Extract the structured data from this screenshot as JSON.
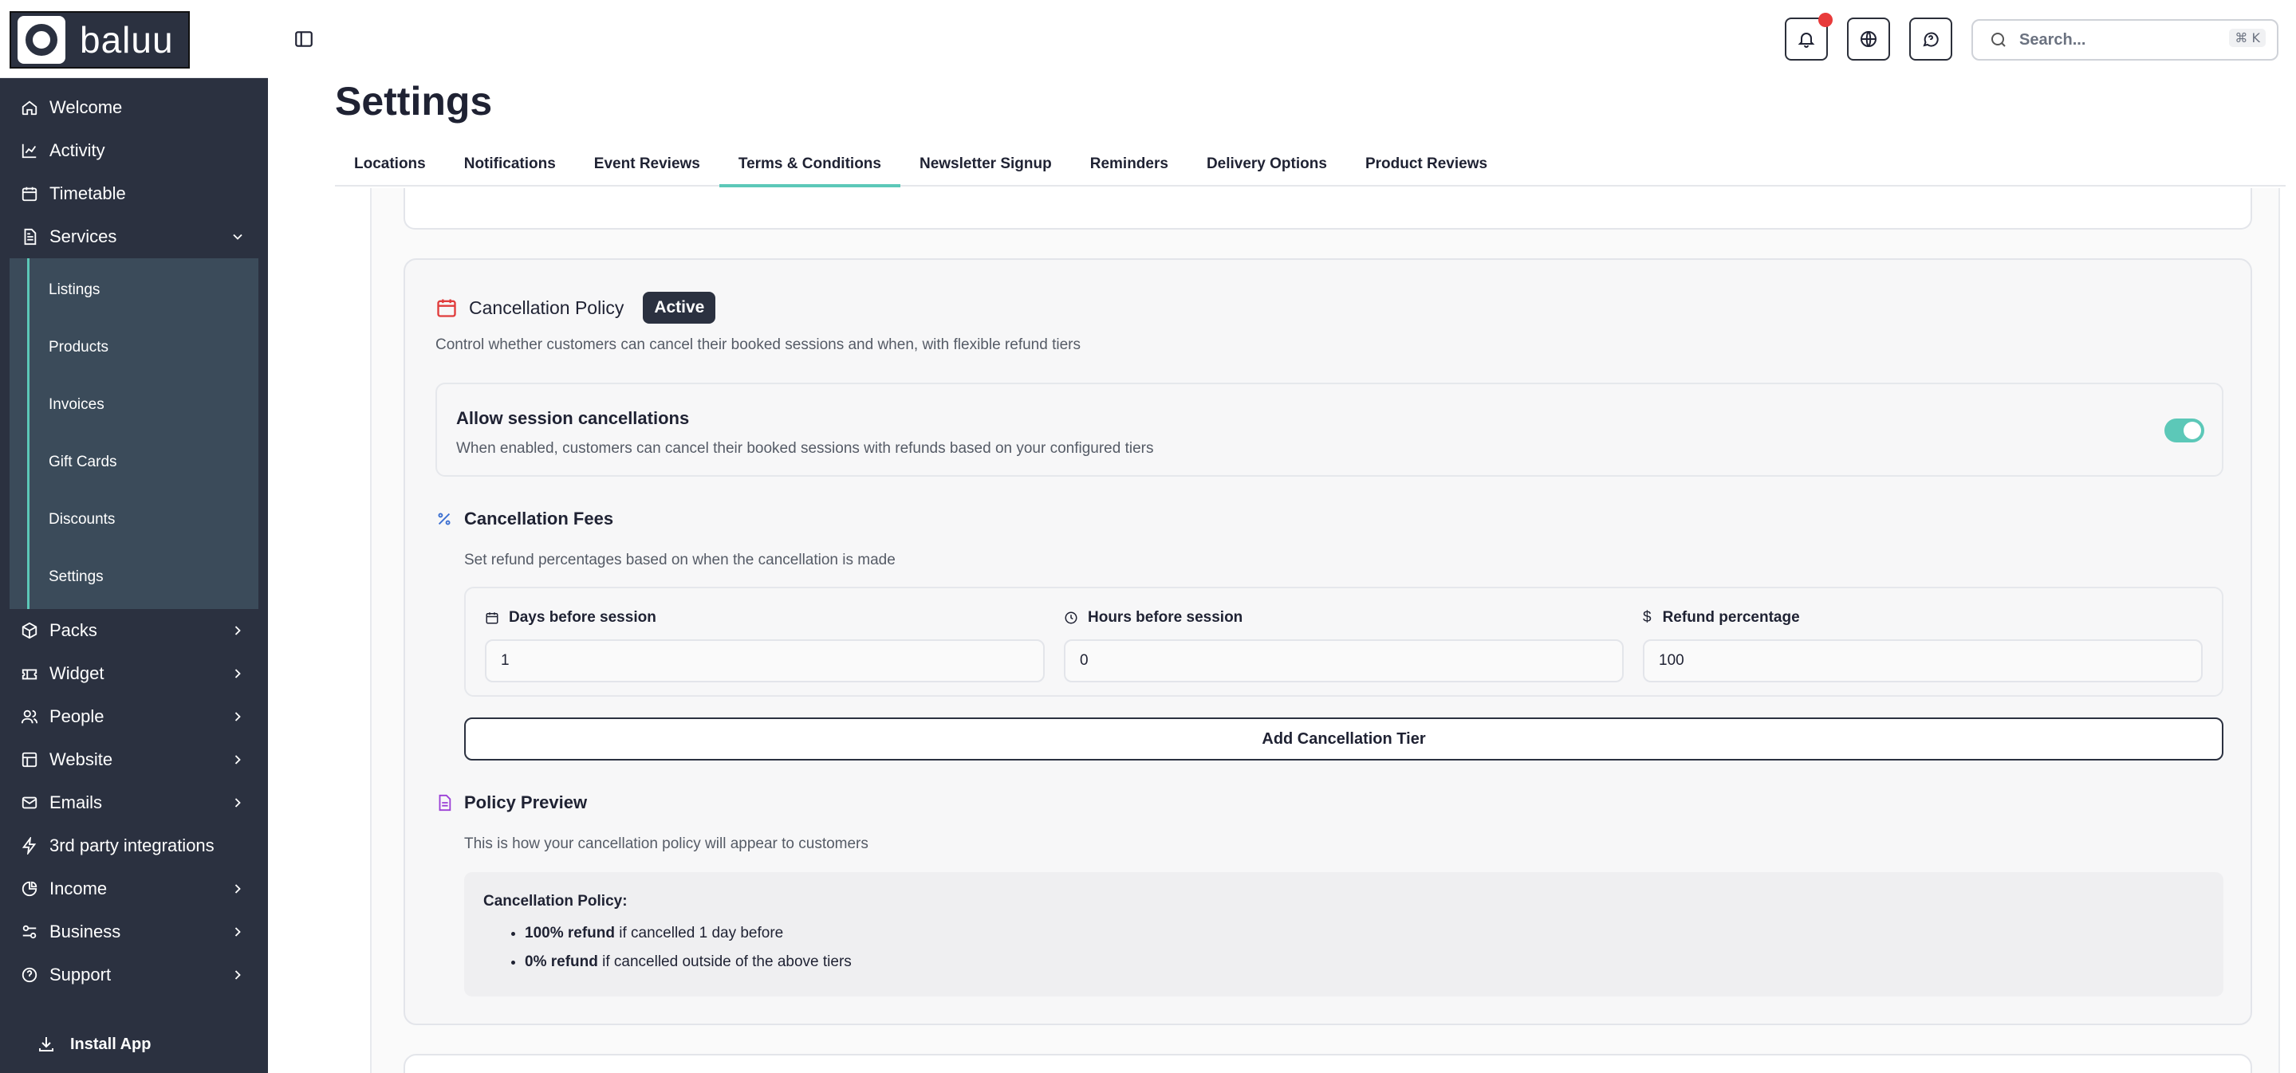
{
  "brand": {
    "name": "baluu"
  },
  "sidebar": {
    "items": [
      {
        "label": "Welcome",
        "icon": "home-icon"
      },
      {
        "label": "Activity",
        "icon": "chart-icon"
      },
      {
        "label": "Timetable",
        "icon": "calendar-icon"
      },
      {
        "label": "Services",
        "icon": "document-icon",
        "expanded": true
      },
      {
        "label": "Packs",
        "icon": "box-icon"
      },
      {
        "label": "Widget",
        "icon": "ticket-icon"
      },
      {
        "label": "People",
        "icon": "people-icon"
      },
      {
        "label": "Website",
        "icon": "layout-icon"
      },
      {
        "label": "Emails",
        "icon": "mail-icon"
      },
      {
        "label": "3rd party integrations",
        "icon": "bolt-icon"
      },
      {
        "label": "Income",
        "icon": "pie-icon"
      },
      {
        "label": "Business",
        "icon": "sliders-icon"
      },
      {
        "label": "Support",
        "icon": "help-icon"
      }
    ],
    "services_sub": [
      "Listings",
      "Products",
      "Invoices",
      "Gift Cards",
      "Discounts",
      "Settings"
    ],
    "install_label": "Install App"
  },
  "topbar": {
    "search_placeholder": "Search...",
    "search_shortcut": "⌘ K"
  },
  "page": {
    "title": "Settings",
    "tabs": [
      "Locations",
      "Notifications",
      "Event Reviews",
      "Terms & Conditions",
      "Newsletter Signup",
      "Reminders",
      "Delivery Options",
      "Product Reviews"
    ],
    "active_tab": "Terms & Conditions"
  },
  "cancellation": {
    "title": "Cancellation Policy",
    "badge": "Active",
    "description": "Control whether customers can cancel their booked sessions and when, with flexible refund tiers",
    "allow": {
      "title": "Allow session cancellations",
      "description": "When enabled, customers can cancel their booked sessions with refunds based on your configured tiers",
      "enabled": true
    },
    "fees": {
      "title": "Cancellation Fees",
      "description": "Set refund percentages based on when the cancellation is made",
      "days_label": "Days before session",
      "days_value": "1",
      "hours_label": "Hours before session",
      "hours_value": "0",
      "refund_label": "Refund percentage",
      "refund_symbol": "$",
      "refund_value": "100"
    },
    "add_tier_label": "Add Cancellation Tier",
    "preview": {
      "title": "Policy Preview",
      "description": "This is how your cancellation policy will appear to customers",
      "box_title": "Cancellation Policy:",
      "rows": [
        {
          "bold": "100% refund",
          "rest": " if cancelled 1 day before"
        },
        {
          "bold": "0% refund",
          "rest": " if cancelled outside of the above tiers"
        }
      ]
    }
  },
  "colors": {
    "sidebar": "#2b3140",
    "accent": "#5cc8b8",
    "danger": "#e03c3c",
    "notification": "#e83a3a"
  }
}
